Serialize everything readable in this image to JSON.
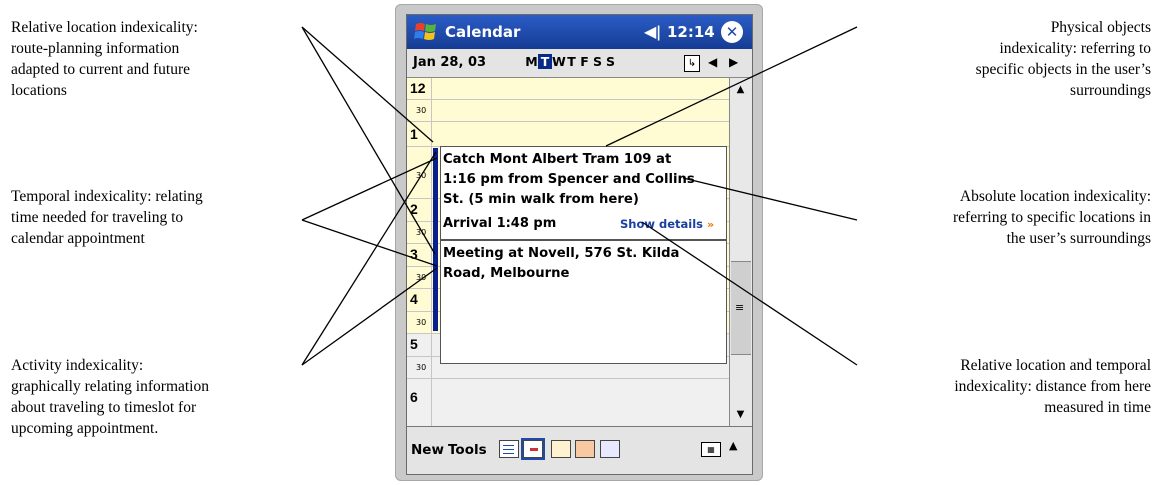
{
  "annotations": {
    "relative_location": [
      "Relative location indexicality:",
      "route-planning information",
      "adapted to current and future",
      "locations"
    ],
    "temporal": [
      "Temporal indexicality: relating",
      "time needed for traveling to",
      "calendar appointment"
    ],
    "activity": [
      "Activity indexicality:",
      "graphically relating information",
      "about traveling to timeslot for",
      "upcoming appointment."
    ],
    "physical_objects": [
      "Physical objects",
      "indexicality: referring to",
      "specific objects in the user’s",
      "surroundings"
    ],
    "absolute_location": [
      "Absolute location indexicality:",
      "referring to specific locations in",
      "the user’s surroundings"
    ],
    "relative_temporal": [
      "Relative location and temporal",
      "indexicality: distance from here",
      "measured in time"
    ]
  },
  "device": {
    "app_title": "Calendar",
    "clock": "12:14",
    "speaker_icon": "speaker-icon",
    "date": "Jan 28, 03",
    "weekdays": [
      "M",
      "T",
      "W",
      "T",
      "F",
      "S",
      "S"
    ],
    "active_weekday_index": 1,
    "hours": {
      "h12": "12",
      "h1": "1",
      "h2": "2",
      "h3": "3",
      "h4": "4",
      "h5": "5",
      "h6": "6"
    },
    "half_label": "30",
    "travel_appointment": {
      "lines": [
        "Catch Mont Albert Tram 109 at",
        "1:16 pm from Spencer and Collins",
        "St. (5 min walk from here)"
      ],
      "arrival": "Arrival 1:48 pm",
      "show_details": "Show details",
      "chevron": "»"
    },
    "meeting_appointment": {
      "lines": [
        "Meeting at Novell, 576 St. Kilda",
        "Road, Melbourne"
      ]
    },
    "menu": {
      "new": "New",
      "tools": "Tools"
    },
    "colors": {
      "title_bar": "#1e4aa8",
      "work_hours": "#fffbd2",
      "travel_bar": "#0a1f8f",
      "link": "#1a3fa0"
    }
  }
}
